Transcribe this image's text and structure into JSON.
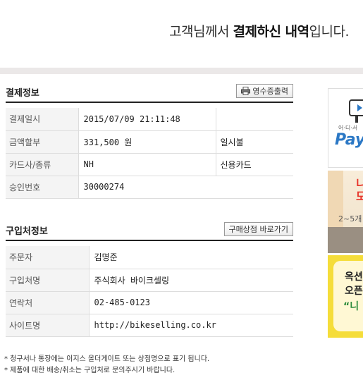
{
  "header": {
    "title_part1": "고객님께서 ",
    "title_bold": "결제하신 내역",
    "title_part2": "입니다."
  },
  "payment": {
    "section_title": "결제정보",
    "receipt_button": "영수증출력",
    "rows": [
      {
        "label": "결제일시",
        "value": "2015/07/09 21:11:48",
        "extra": ""
      },
      {
        "label": "금액할부",
        "value": "331,500 원",
        "extra": "일시불"
      },
      {
        "label": "카드사/종류",
        "value": "NH",
        "extra": "신용카드"
      },
      {
        "label": "승인번호",
        "value": "30000274"
      }
    ]
  },
  "purchase": {
    "section_title": "구입처정보",
    "shop_button": "구매상점 바로가기",
    "rows": [
      {
        "label": "주문자",
        "value": "김명준"
      },
      {
        "label": "구입처명",
        "value": "주식회사 바이크셀링"
      },
      {
        "label": "연락처",
        "value": "02-485-0123"
      },
      {
        "label": "사이트명",
        "value": "http://bikeselling.co.kr"
      }
    ]
  },
  "notes": [
    "* 청구서나 통장에는 이지스 올더게이트 또는 상점명으로 표기 됩니다.",
    "* 제품에 대한 배송/취소는 구입처로 문의주시기 바랍니다."
  ],
  "ads": {
    "ad1_small": "어·디·서",
    "ad1_big": "Pay",
    "ad2_big": "니\n모",
    "ad2_small": "2~5개",
    "ad3_line1": "옥션",
    "ad3_line2": "오픈",
    "ad3_line3": "“니"
  },
  "colors": {
    "accent_blue": "#2b78c5",
    "ad_red": "#e8352b",
    "ad_yellow": "#f5dd3a",
    "ad_green": "#2a8a3b"
  },
  "icons": {
    "print": "printer-icon"
  }
}
